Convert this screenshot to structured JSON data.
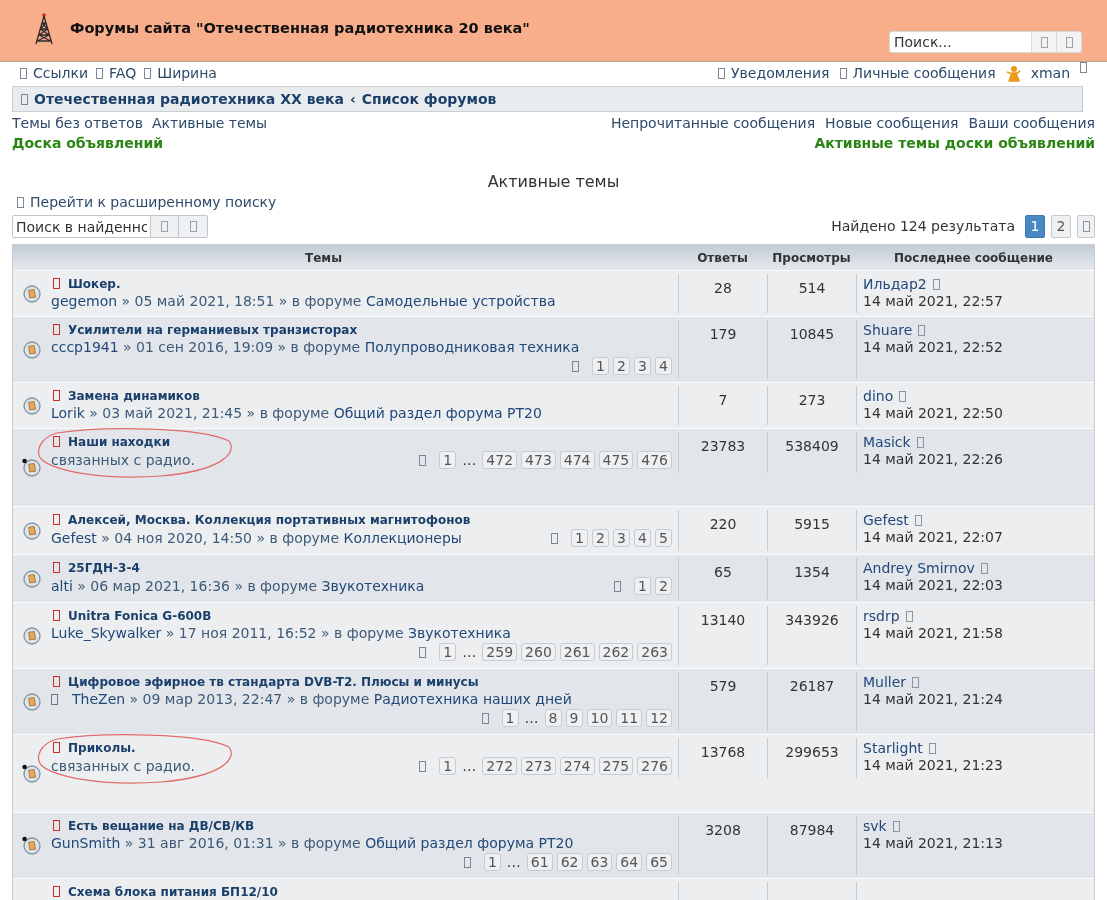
{
  "header": {
    "title": "Форумы сайта \"Отечественная радиотехника 20 века\"",
    "search": {
      "placeholder": "Поиск..."
    }
  },
  "nav": {
    "left": [
      "Ссылки",
      "FAQ",
      "Ширина"
    ],
    "right": [
      "Уведомления",
      "Личные сообщения"
    ],
    "user": "xman"
  },
  "breadcrumbs": {
    "items": [
      "Отечественная радиотехника XX века",
      "Список форумов"
    ],
    "separator": "‹"
  },
  "quick_links": {
    "left": [
      "Темы без ответов",
      "Активные темы"
    ],
    "right": [
      "Непрочитанные сообщения",
      "Новые сообщения",
      "Ваши сообщения"
    ]
  },
  "board_links": {
    "left": "Доска объявлений",
    "right": "Активные темы доски объявлений"
  },
  "page_title": "Активные темы",
  "advanced_search": "Перейти к расширенному поиску",
  "result_search": {
    "value": "Поиск в найденнс"
  },
  "results": "Найдено 124 результата",
  "pagination": [
    {
      "label": "1",
      "selected": true
    },
    {
      "label": "2",
      "selected": false
    }
  ],
  "table": {
    "columns": [
      "Темы",
      "Ответы",
      "Просмотры",
      "Последнее сообщение"
    ],
    "rows": [
      {
        "title": "Шокер.",
        "author": "gegemon",
        "info": "» 05 май 2021, 18:51 » в форуме",
        "forum": "Самодельные устройства",
        "replies": "28",
        "views": "514",
        "last_author": "Ильдар2",
        "last_time": "14 май 2021, 22:57",
        "posted": false,
        "attachment": false,
        "circled": false
      },
      {
        "title": "Усилители на германиевых транзисторах",
        "author": "cccp1941",
        "info": "» 01 сен 2016, 19:09 » в форуме",
        "forum": "Полупроводниковая техника",
        "pages": [
          {
            "label": "1",
            "kind": "page"
          },
          {
            "label": "2",
            "kind": "page"
          },
          {
            "label": "3",
            "kind": "page"
          },
          {
            "label": "4",
            "kind": "page"
          }
        ],
        "replies": "179",
        "views": "10845",
        "last_author": "Shuare",
        "last_time": "14 май 2021, 22:52",
        "posted": false,
        "attachment": false,
        "circled": false
      },
      {
        "title": "Замена динамиков",
        "author": "Lorik",
        "info": "» 03 май 2021, 21:45 » в форуме",
        "forum": "Общий раздел форума РТ20",
        "replies": "7",
        "views": "273",
        "last_author": "dino",
        "last_time": "14 май 2021, 22:50",
        "posted": false,
        "attachment": false,
        "circled": false
      },
      {
        "title": "Наши находки",
        "description": "связанных с радио.",
        "pages": [
          {
            "label": "1",
            "kind": "page"
          },
          {
            "label": "…",
            "kind": "gap"
          },
          {
            "label": "472",
            "kind": "page"
          },
          {
            "label": "473",
            "kind": "page"
          },
          {
            "label": "474",
            "kind": "page"
          },
          {
            "label": "475",
            "kind": "page"
          },
          {
            "label": "476",
            "kind": "page"
          }
        ],
        "replies": "23783",
        "views": "538409",
        "last_author": "Masick",
        "last_time": "14 май 2021, 22:26",
        "posted": true,
        "attachment": false,
        "circled": true
      },
      {
        "title": "Алексей, Москва. Коллекция портативных магнитофонов",
        "author": "Gefest",
        "info": "» 04 ноя 2020, 14:50 » в форуме",
        "forum": "Коллекционеры",
        "pages": [
          {
            "label": "1",
            "kind": "page"
          },
          {
            "label": "2",
            "kind": "page"
          },
          {
            "label": "3",
            "kind": "page"
          },
          {
            "label": "4",
            "kind": "page"
          },
          {
            "label": "5",
            "kind": "page"
          }
        ],
        "replies": "220",
        "views": "5915",
        "last_author": "Gefest",
        "last_time": "14 май 2021, 22:07",
        "posted": false,
        "attachment": false,
        "circled": false
      },
      {
        "title": "25ГДН-3-4",
        "author": "alti",
        "info": "» 06 мар 2021, 16:36 » в форуме",
        "forum": "Звукотехника",
        "pages": [
          {
            "label": "1",
            "kind": "page"
          },
          {
            "label": "2",
            "kind": "page"
          }
        ],
        "replies": "65",
        "views": "1354",
        "last_author": "Andrey Smirnov",
        "last_time": "14 май 2021, 22:03",
        "posted": false,
        "attachment": false,
        "circled": false
      },
      {
        "title": "Unitra Fonica G-600B",
        "author": "Luke_Skywalker",
        "info": "» 17 ноя 2011, 16:52 » в форуме",
        "forum": "Звукотехника",
        "pages": [
          {
            "label": "1",
            "kind": "page"
          },
          {
            "label": "…",
            "kind": "gap"
          },
          {
            "label": "259",
            "kind": "page"
          },
          {
            "label": "260",
            "kind": "page"
          },
          {
            "label": "261",
            "kind": "page"
          },
          {
            "label": "262",
            "kind": "page"
          },
          {
            "label": "263",
            "kind": "page"
          }
        ],
        "replies": "13140",
        "views": "343926",
        "last_author": "rsdrp",
        "last_time": "14 май 2021, 21:58",
        "posted": false,
        "attachment": false,
        "circled": false
      },
      {
        "title": "Цифровое эфирное тв стандарта DVB-T2. Плюсы и минусы",
        "author": "TheZen",
        "info": "» 09 мар 2013, 22:47 » в форуме",
        "forum": "Радиотехника наших дней",
        "pages": [
          {
            "label": "1",
            "kind": "page"
          },
          {
            "label": "…",
            "kind": "gap"
          },
          {
            "label": "8",
            "kind": "page"
          },
          {
            "label": "9",
            "kind": "page"
          },
          {
            "label": "10",
            "kind": "page"
          },
          {
            "label": "11",
            "kind": "page"
          },
          {
            "label": "12",
            "kind": "page"
          }
        ],
        "replies": "579",
        "views": "26187",
        "last_author": "Muller",
        "last_time": "14 май 2021, 21:24",
        "posted": false,
        "attachment": true,
        "circled": false
      },
      {
        "title": "Приколы.",
        "description": "связанных с радио.",
        "pages": [
          {
            "label": "1",
            "kind": "page"
          },
          {
            "label": "…",
            "kind": "gap"
          },
          {
            "label": "272",
            "kind": "page"
          },
          {
            "label": "273",
            "kind": "page"
          },
          {
            "label": "274",
            "kind": "page"
          },
          {
            "label": "275",
            "kind": "page"
          },
          {
            "label": "276",
            "kind": "page"
          }
        ],
        "replies": "13768",
        "views": "299653",
        "last_author": "Starlight",
        "last_time": "14 май 2021, 21:23",
        "posted": true,
        "attachment": false,
        "circled": true
      },
      {
        "title": "Есть вещание на ДВ/СВ/КВ",
        "author": "GunSmith",
        "info": "» 31 авг 2016, 01:31 » в форуме",
        "forum": "Общий раздел форума РТ20",
        "pages": [
          {
            "label": "1",
            "kind": "page"
          },
          {
            "label": "…",
            "kind": "gap"
          },
          {
            "label": "61",
            "kind": "page"
          },
          {
            "label": "62",
            "kind": "page"
          },
          {
            "label": "63",
            "kind": "page"
          },
          {
            "label": "64",
            "kind": "page"
          },
          {
            "label": "65",
            "kind": "page"
          }
        ],
        "replies": "3208",
        "views": "87984",
        "last_author": "svk",
        "last_time": "14 май 2021, 21:13",
        "posted": true,
        "attachment": false,
        "circled": false
      },
      {
        "title": "Схема блока питания БП12/10"
      }
    ]
  }
}
